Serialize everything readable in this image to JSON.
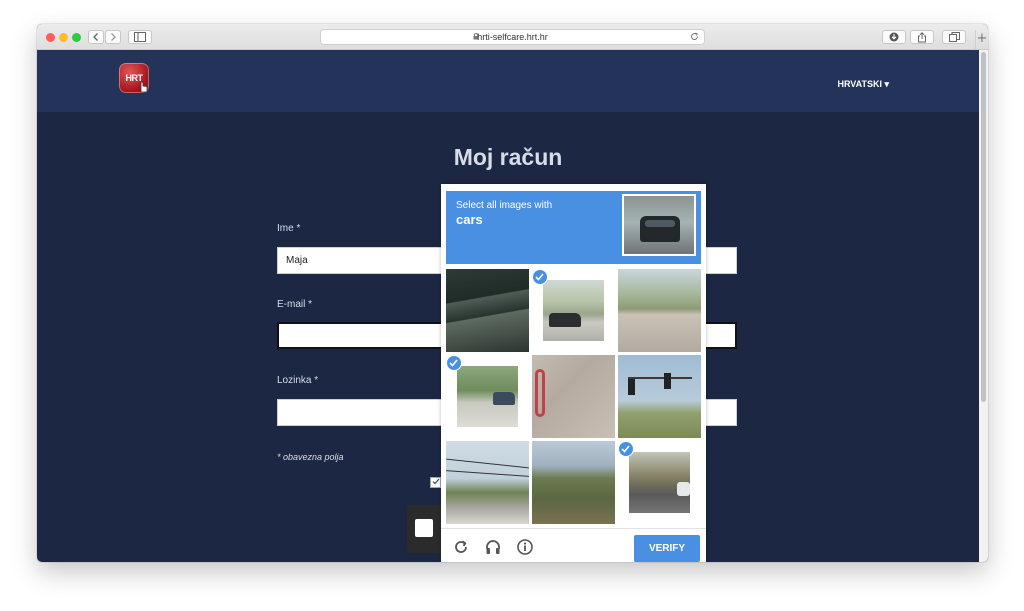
{
  "browser": {
    "url": "hrti-selfcare.hrt.hr",
    "new_tab_symbol": "+"
  },
  "site": {
    "logo_text": "HRT",
    "language_label": "HRVATSKI ▾"
  },
  "form": {
    "title": "Moj račun",
    "name_label": "Ime *",
    "name_value": "Maja",
    "email_label": "E-mail *",
    "email_value": "",
    "password_label": "Lozinka *",
    "password_value": "",
    "required_note": "* obavezna polja"
  },
  "captcha": {
    "prompt": "Select all images with",
    "keyword": "cars",
    "verify_label": "VERIFY",
    "tiles": [
      {
        "subject": "overpass",
        "selected": false
      },
      {
        "subject": "car-on-street",
        "selected": true
      },
      {
        "subject": "road-crosswalk",
        "selected": false
      },
      {
        "subject": "car-under-tree",
        "selected": true
      },
      {
        "subject": "pavement-closeup",
        "selected": false
      },
      {
        "subject": "traffic-light",
        "selected": false
      },
      {
        "subject": "power-lines-house",
        "selected": false
      },
      {
        "subject": "palm-trees-hill",
        "selected": false
      },
      {
        "subject": "car-on-highway",
        "selected": true
      }
    ],
    "icons": [
      "reload-icon",
      "audio-icon",
      "info-icon"
    ]
  },
  "colors": {
    "page_background": "#1c2744",
    "header_background": "#24335a",
    "captcha_accent": "#4a90e2"
  }
}
